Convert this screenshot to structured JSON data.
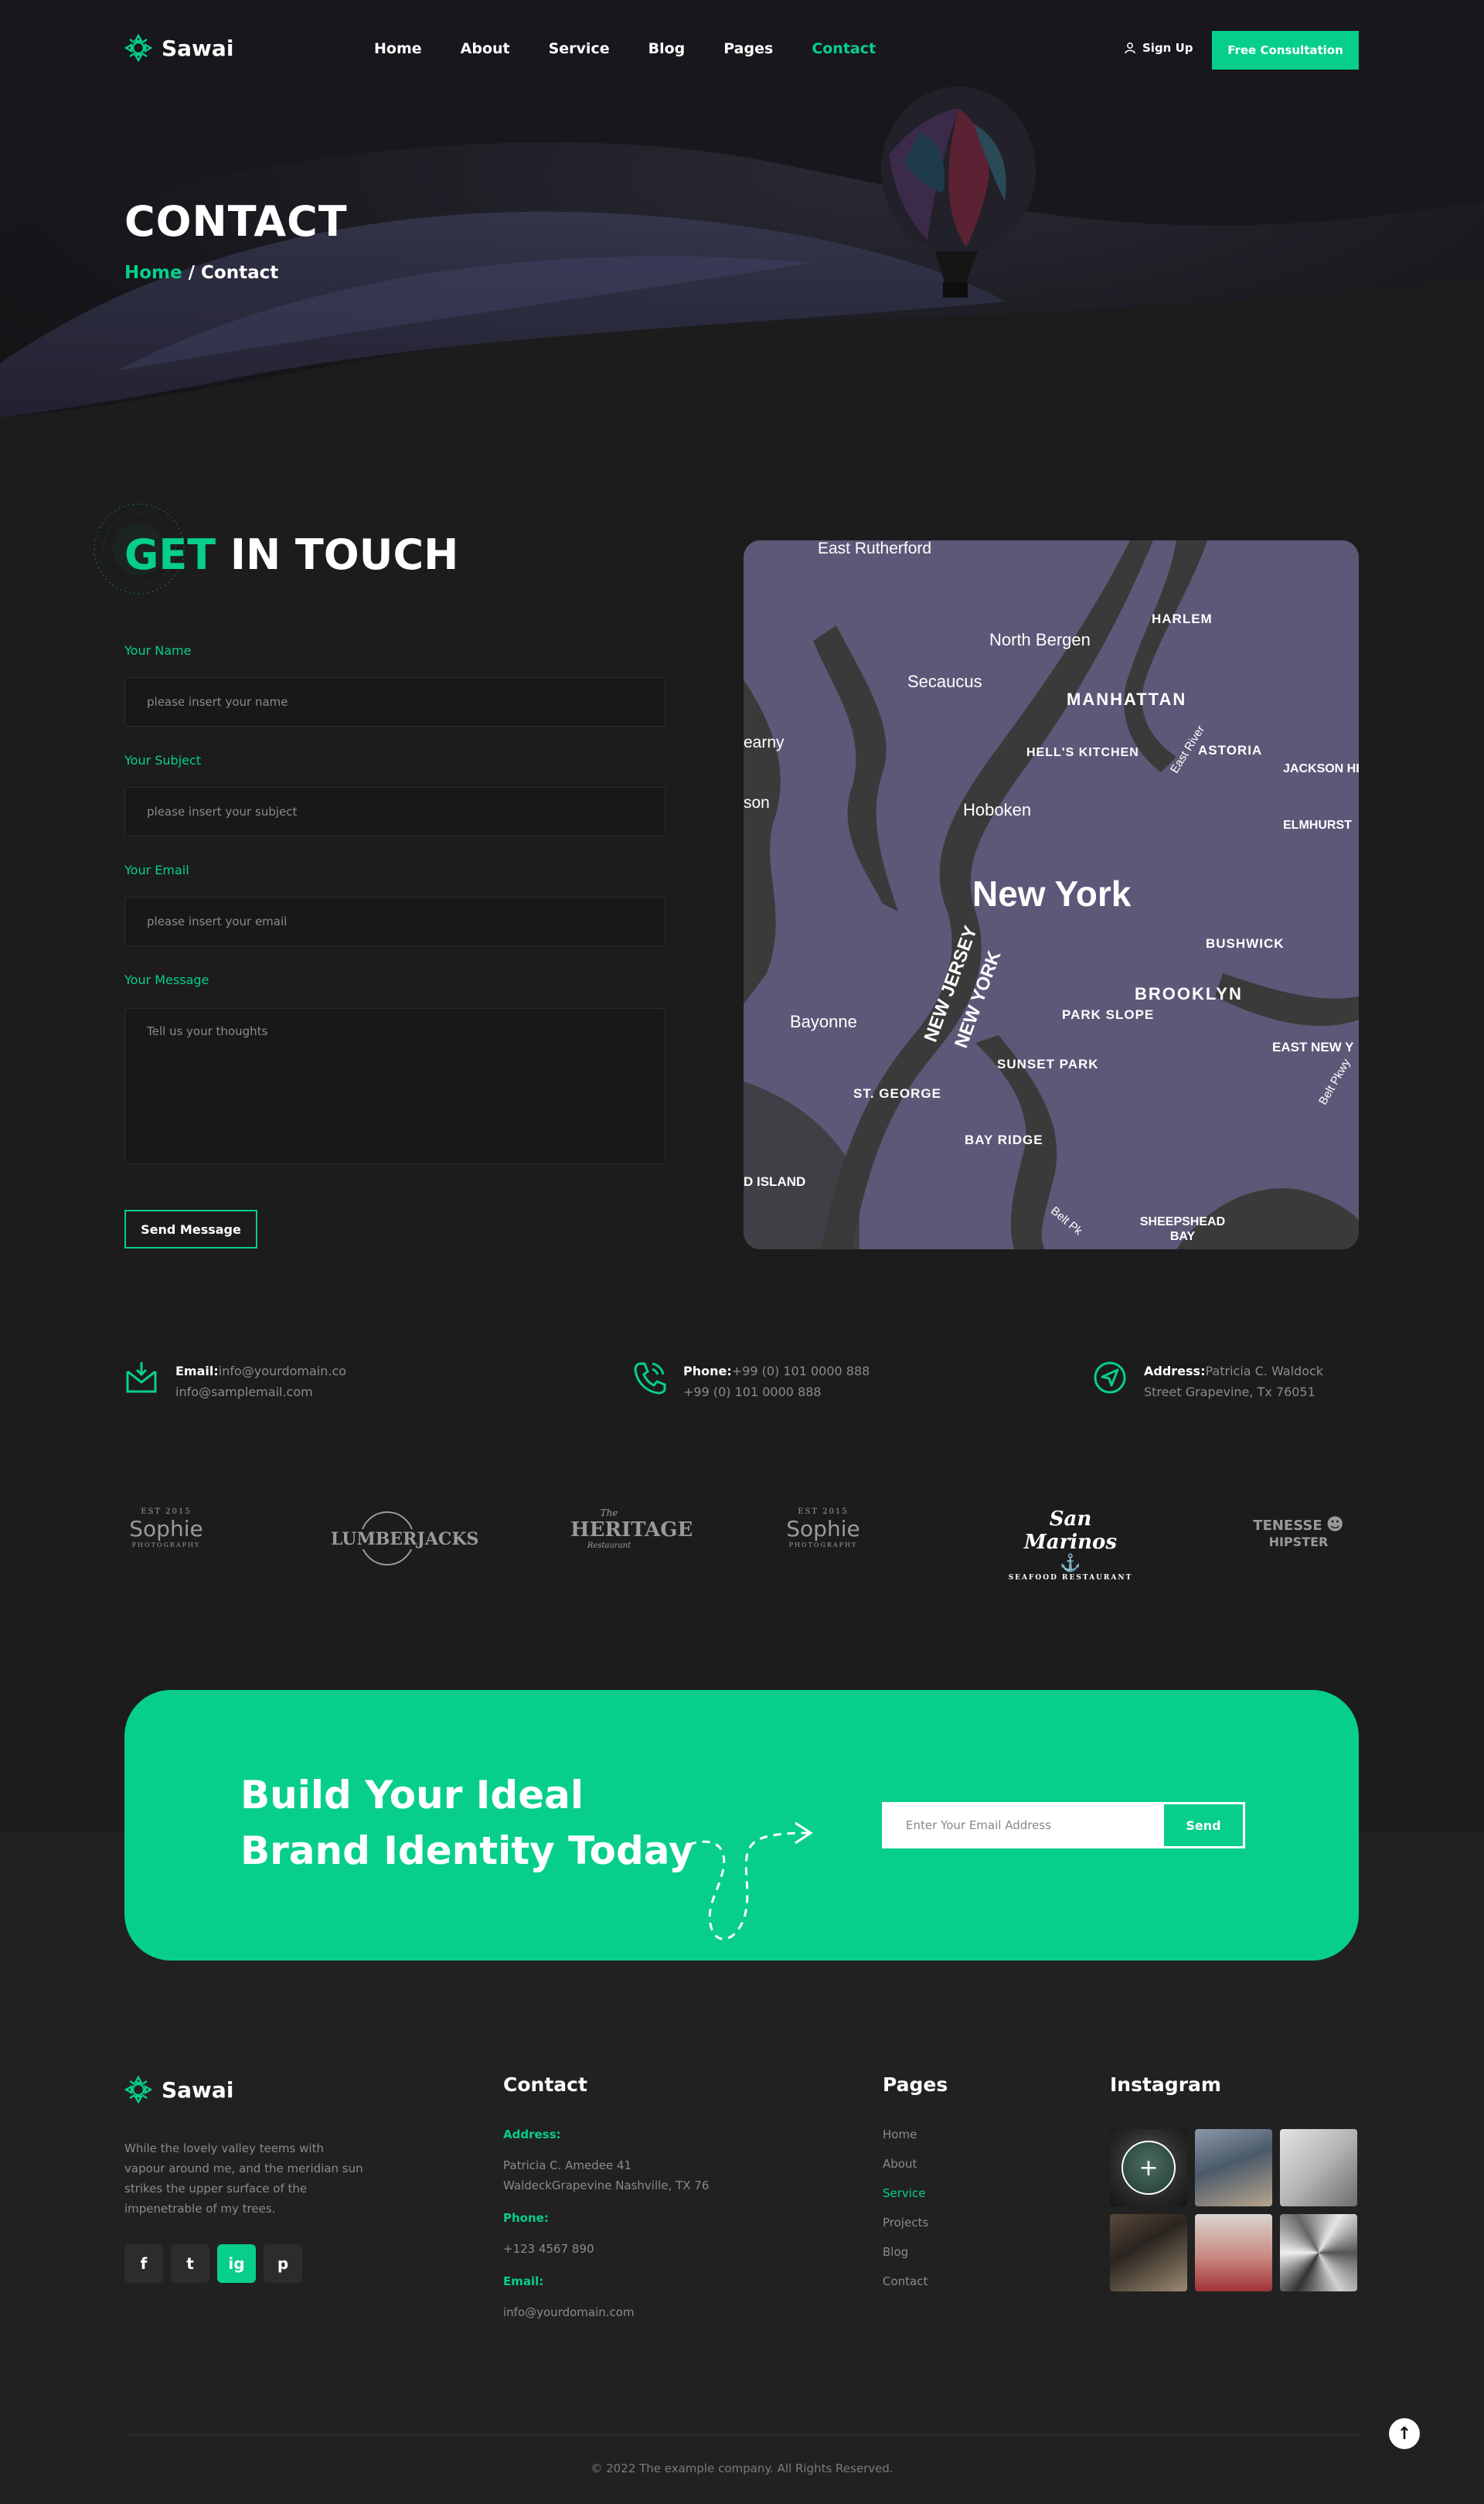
{
  "brand": {
    "name": "Sawai",
    "accent": "#07cf8b"
  },
  "nav": {
    "items": [
      "Home",
      "About",
      "Service",
      "Blog",
      "Pages",
      "Contact"
    ],
    "active": "Contact",
    "signup": "Sign Up",
    "cta": "Free Consultation"
  },
  "hero": {
    "title": "CONTACT",
    "breadcrumb_home": "Home",
    "breadcrumb_sep": " / ",
    "breadcrumb_current": "Contact"
  },
  "contact_form": {
    "title_accent": "GET",
    "title_rest": " IN TOUCH",
    "fields": [
      {
        "label": "Your Name",
        "placeholder": "please insert your name"
      },
      {
        "label": "Your Subject",
        "placeholder": "please insert your subject"
      },
      {
        "label": "Your Email",
        "placeholder": "please insert your email"
      },
      {
        "label": "Your Message",
        "placeholder": "Tell us your thoughts"
      }
    ],
    "submit": "Send Message"
  },
  "map": {
    "labels": {
      "east_rutherford": "East Rutherford",
      "north_bergen": "North Bergen",
      "secaucus": "Secaucus",
      "manhattan": "MANHATTAN",
      "harlem": "HARLEM",
      "hells_kitchen": "HELL'S KITCHEN",
      "east_river": "East River",
      "astoria": "ASTORIA",
      "jackson_heights": "JACKSON HEIGHTS",
      "elmhurst": "ELMHURST",
      "kearny": "earny",
      "hoboken": "Hoboken",
      "harrison": "son",
      "new_york": "New York",
      "bushwick": "BUSHWICK",
      "brooklyn": "BROOKLYN",
      "new_jersey": "NEW JERSEY",
      "new_york_state": "NEW YORK",
      "park_slope": "PARK SLOPE",
      "east_new_york": "EAST NEW Y",
      "bayonne": "Bayonne",
      "sunset_park": "SUNSET PARK",
      "st_george": "ST. GEORGE",
      "bay_ridge": "BAY RIDGE",
      "belt_pkwy": "Belt Pkwy",
      "island": "D ISLAND",
      "belt_pk": "Belt Pk",
      "sheepshead": "SHEEPSHEAD BAY"
    }
  },
  "info": {
    "email_label": "Email:",
    "email_1": "info@yourdomain.co",
    "email_2": "info@samplemail.com",
    "phone_label": "Phone:",
    "phone_1": "+99 (0) 101 0000 888",
    "phone_2": "+99 (0) 101 0000 888",
    "address_label": "Address:",
    "address_1": "Patricia C. Waldock",
    "address_2": "Street Grapevine, Tx 76051"
  },
  "brands": [
    {
      "name": "Sophie",
      "top": "EST 2015",
      "bottom": "PHOTOGRAPHY"
    },
    {
      "name": "LUMBERJACKS",
      "top": "",
      "bottom": ""
    },
    {
      "name": "HERITAGE",
      "top": "The",
      "bottom": "Restaurant"
    },
    {
      "name": "Sophie",
      "top": "EST 2015",
      "bottom": "PHOTOGRAPHY"
    },
    {
      "name": "San Marinos",
      "top": "",
      "bottom": "SEAFOOD RESTAURANT"
    },
    {
      "name": "TENESSE",
      "top": "",
      "bottom": "HIPSTER"
    }
  ],
  "cta": {
    "line1": "Build Your Ideal",
    "line2": "Brand Identity Today",
    "placeholder": "Enter Your Email Address",
    "send": "Send"
  },
  "footer": {
    "about": "While the lovely valley teems with vapour around me, and the meridian sun strikes the upper surface of the impenetrable of my trees.",
    "contact_title": "Contact",
    "address_label": "Address:",
    "address_line1": "Patricia C. Amedee 41",
    "address_line2": "WaldeckGrapevine Nashville, TX 76",
    "phone_label": "Phone:",
    "phone": "+123 4567 890",
    "email_label": "Email:",
    "email": "info@yourdomain.com",
    "pages_title": "Pages",
    "pages": [
      "Home",
      "About",
      "Service",
      "Projects",
      "Blog",
      "Contact"
    ],
    "pages_active": "Service",
    "instagram_title": "Instagram",
    "socials": [
      "f",
      "t",
      "ig",
      "p"
    ],
    "copyright": "© 2022 The example company. All Rights Reserved."
  }
}
